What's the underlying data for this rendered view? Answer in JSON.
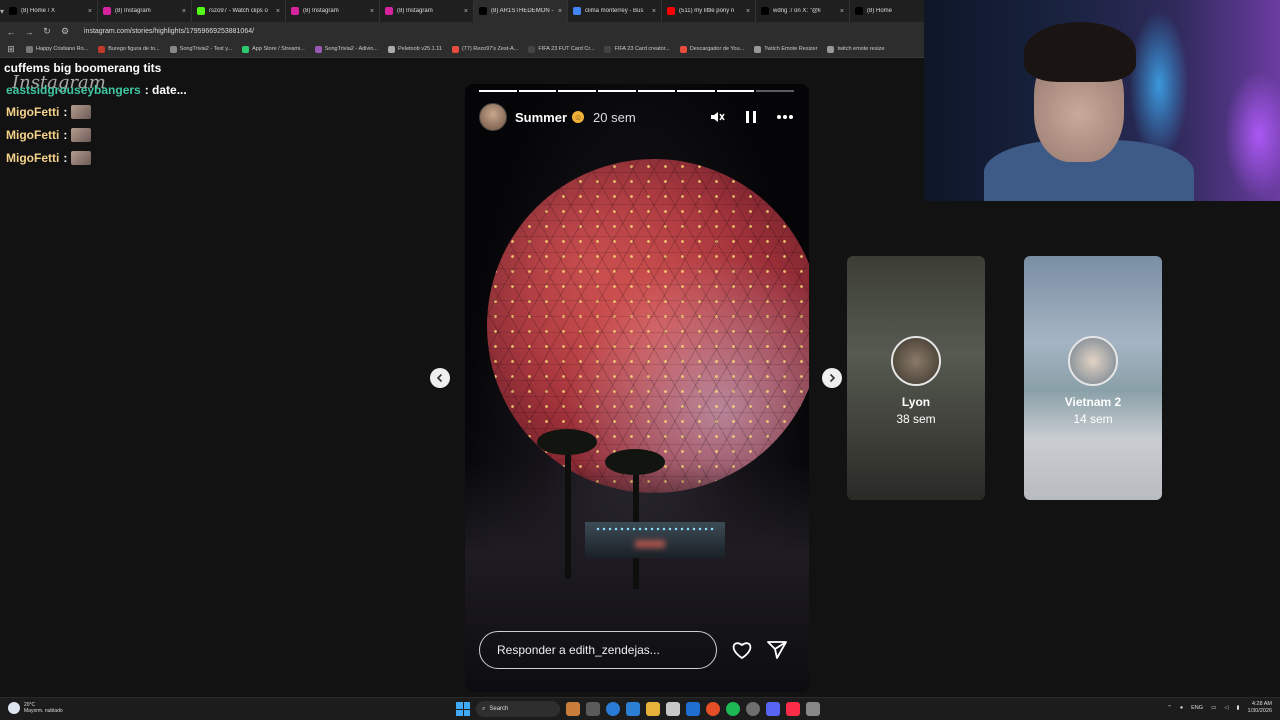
{
  "browser": {
    "tabs": [
      {
        "title": "(8) Home / X",
        "color": "#000000"
      },
      {
        "title": "(8) Instagram",
        "color": "#d6249f"
      },
      {
        "title": "rszo97 - Watch clips o",
        "color": "#53fc18"
      },
      {
        "title": "(8) Instagram",
        "color": "#d6249f"
      },
      {
        "title": "(8) Instagram",
        "color": "#d6249f"
      },
      {
        "title": "(8) AR1STHEDEMON -",
        "color": "#000000"
      },
      {
        "title": "clima monterrey - Bus",
        "color": "#4285f4"
      },
      {
        "title": "(511) my little pony n",
        "color": "#ff0000"
      },
      {
        "title": "wdng :/ on X: \"@li",
        "color": "#000000"
      },
      {
        "title": "(8) Home",
        "color": "#000000"
      }
    ],
    "url": "instagram.com/stories/highlights/17959669253881064/",
    "bookmarks": [
      {
        "label": "Happy Cristiano Ro...",
        "color": "#777777"
      },
      {
        "label": "Burego figura de to...",
        "color": "#c0392b"
      },
      {
        "label": "SongTrivia2 - Test y...",
        "color": "#888888"
      },
      {
        "label": "App Store / Streami...",
        "color": "#2ecc71"
      },
      {
        "label": "SongTrivia2 - Adivin...",
        "color": "#9b59b6"
      },
      {
        "label": "Peletoob v25.1.11",
        "color": "#aaaaaa"
      },
      {
        "label": "(77) Rezo97's Zest-A...",
        "color": "#e74c3c"
      },
      {
        "label": "FIFA 23 FUT Card Cr...",
        "color": "#444444"
      },
      {
        "label": "FIFA 23 Card creator...",
        "color": "#444444"
      },
      {
        "label": "Descargador de You...",
        "color": "#e74c3c"
      },
      {
        "label": "Twitch Emote Resizer",
        "color": "#999999"
      },
      {
        "label": "twitch emote resize",
        "color": "#999999"
      }
    ]
  },
  "chat": {
    "title": "cuffems big boomerang tits",
    "logo": "Instagram",
    "lines": [
      {
        "user": "eastsidgrouseybangers",
        "msg": ": date...",
        "green": true
      },
      {
        "user": "MigoFetti",
        "msg": ":",
        "green": false
      },
      {
        "user": "MigoFetti",
        "msg": ":",
        "green": false
      },
      {
        "user": "MigoFetti",
        "msg": ":",
        "green": false
      }
    ]
  },
  "story": {
    "username": "Summer",
    "time": "20 sem",
    "reply_placeholder": "Responder a edith_zendejas...",
    "progress": {
      "segments": 8,
      "done": 7
    }
  },
  "previews": [
    {
      "name": "Lyon",
      "time": "38 sem"
    },
    {
      "name": "Vietnam 2",
      "time": "14 sem"
    }
  ],
  "taskbar": {
    "weather_temp": "20°C",
    "weather_desc": "Mayorm. nublado",
    "search_label": "Search",
    "lang": "ENG",
    "time": "4:28 AM",
    "date": "1/30/2026"
  }
}
